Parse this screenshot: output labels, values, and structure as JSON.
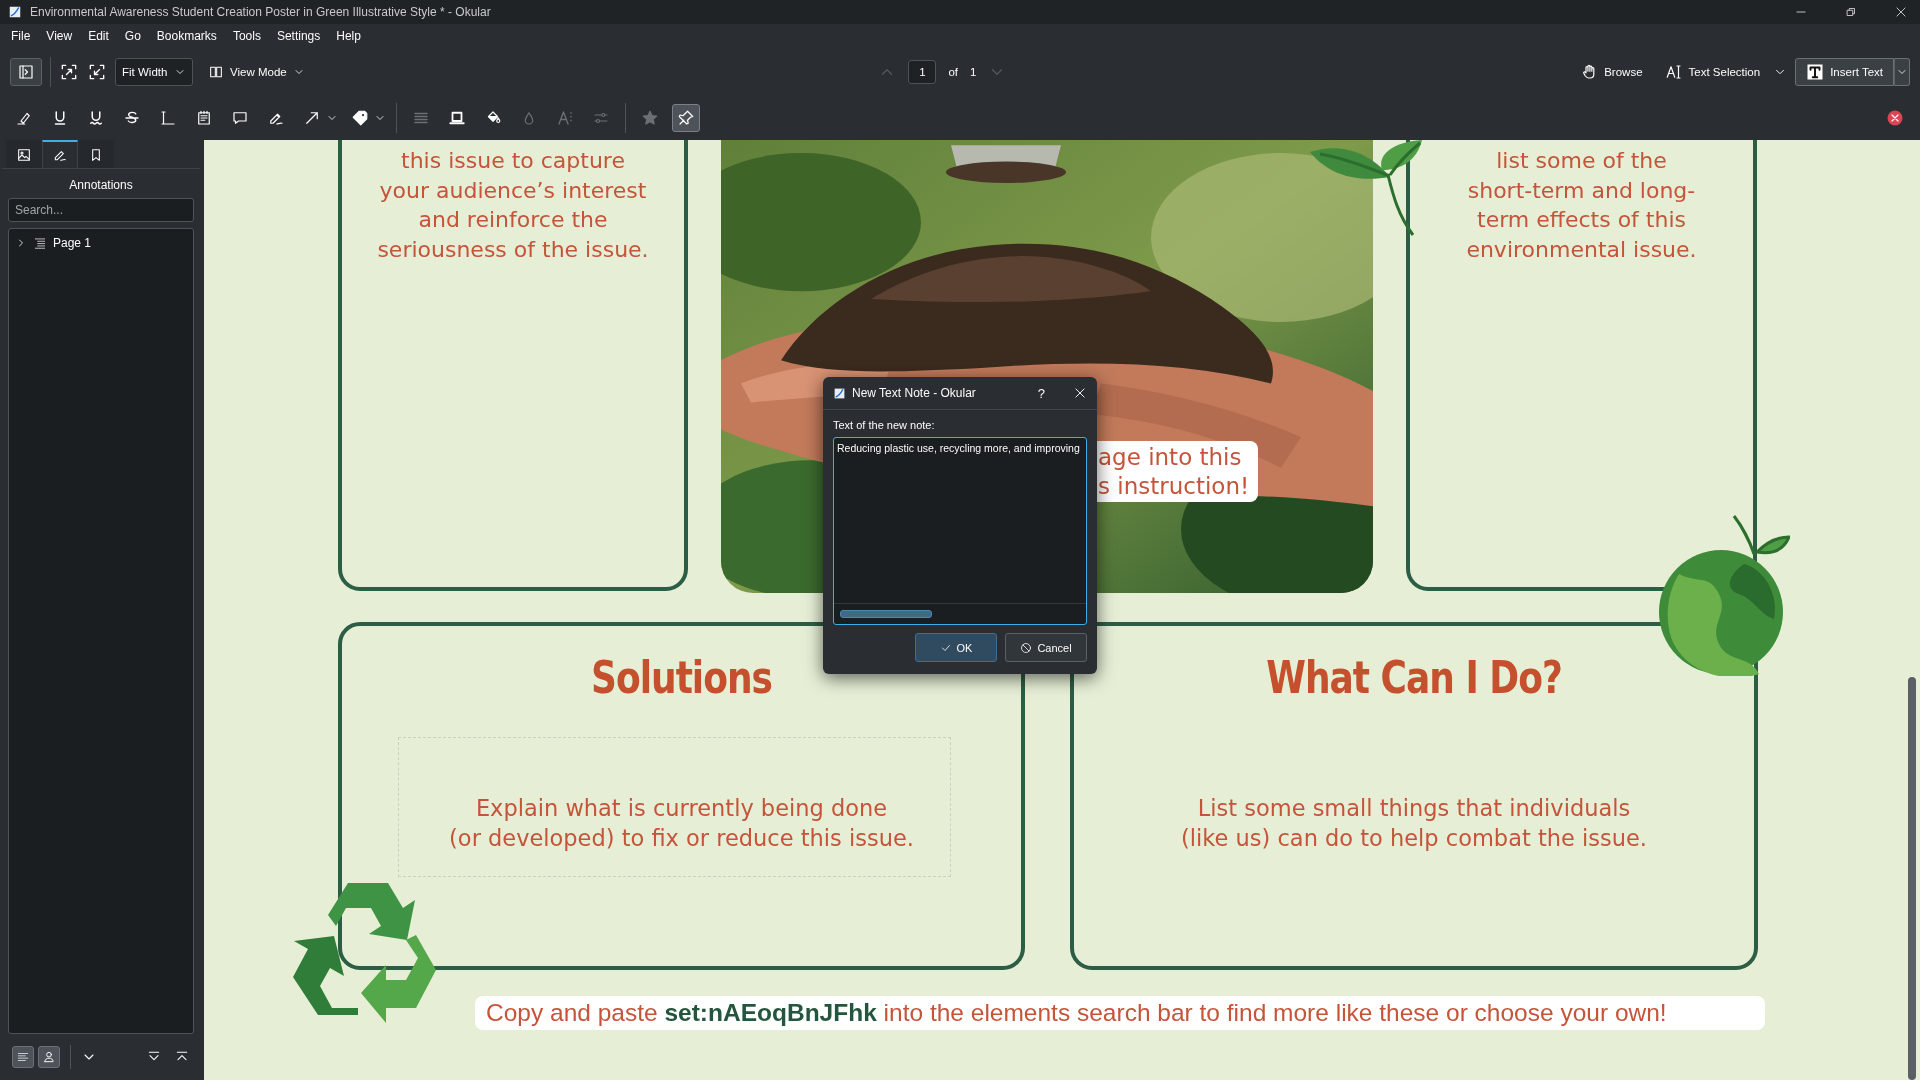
{
  "window": {
    "title": "Environmental Awareness Student Creation Poster in Green Illustrative Style * - Okular"
  },
  "menu": [
    "File",
    "View",
    "Edit",
    "Go",
    "Bookmarks",
    "Tools",
    "Settings",
    "Help"
  ],
  "toolbar": {
    "sidebar_toggle": {
      "on": true
    },
    "zoom": "Fit Width",
    "view_mode": "View Mode",
    "page": {
      "current": "1",
      "of": "of",
      "total": "1"
    },
    "modes": [
      {
        "kind": "browse",
        "label": "Browse",
        "selected": false
      },
      {
        "kind": "text_selection",
        "label": "Text Selection",
        "selected": false
      },
      {
        "kind": "insert_text",
        "label": "Insert Text",
        "selected": true
      }
    ]
  },
  "annotation_tool_groups": [
    {
      "tools": [
        {
          "kind": "highlighter",
          "disabled": false,
          "selected": false
        },
        {
          "kind": "underline",
          "disabled": false,
          "selected": false
        },
        {
          "kind": "squiggle",
          "disabled": false,
          "selected": false
        },
        {
          "kind": "strikeout",
          "disabled": false,
          "selected": false
        },
        {
          "kind": "typewriter",
          "disabled": false,
          "selected": false
        },
        {
          "kind": "note",
          "disabled": false,
          "selected": false
        },
        {
          "kind": "comment",
          "disabled": false,
          "selected": false
        },
        {
          "kind": "freehand",
          "disabled": false,
          "selected": false
        },
        {
          "kind": "arrow",
          "disabled": false,
          "selected": false,
          "has_menu": true
        },
        {
          "kind": "stamp",
          "disabled": false,
          "selected": false,
          "has_menu": true
        }
      ]
    },
    {
      "tools": [
        {
          "kind": "width",
          "disabled": true,
          "selected": false
        },
        {
          "kind": "border",
          "disabled": false,
          "selected": false
        },
        {
          "kind": "fill",
          "disabled": false,
          "selected": false
        },
        {
          "kind": "opacity",
          "disabled": true,
          "selected": false
        },
        {
          "kind": "font",
          "disabled": true,
          "selected": false
        },
        {
          "kind": "settings",
          "disabled": true,
          "selected": false
        }
      ]
    },
    {
      "tools": [
        {
          "kind": "star",
          "disabled": true,
          "selected": false
        },
        {
          "kind": "pin",
          "disabled": false,
          "selected": true
        }
      ]
    }
  ],
  "sidebar": {
    "tabs": [
      {
        "kind": "thumbnails",
        "selected": false
      },
      {
        "kind": "annotations",
        "selected": true
      },
      {
        "kind": "bookmarks",
        "selected": false
      }
    ],
    "title": "Annotations",
    "search": {
      "placeholder": "Search..."
    },
    "tree": [
      {
        "label": "Page 1",
        "expanded": false
      }
    ],
    "toggles": [
      {
        "kind": "list",
        "on": true
      },
      {
        "kind": "author",
        "on": true
      }
    ]
  },
  "document": {
    "cards": [
      {
        "kind": "text",
        "lines": [
          "this issue to capture",
          "your audience’s interest",
          "and reinforce the",
          "seriousness of the issue."
        ]
      },
      {
        "kind": "text",
        "lines": [
          "list some of the",
          "short-term and long-",
          "term effects of this",
          "environmental issue."
        ]
      },
      {
        "kind": "section",
        "title": "Solutions",
        "lines": [
          "Explain what is currently being done",
          "(or developed) to fix or reduce this issue."
        ],
        "dashed": true
      },
      {
        "kind": "section",
        "title": "What Can I Do?",
        "lines": [
          "List some small things that individuals",
          "(like us) can do to help combat the issue."
        ],
        "dashed": false
      }
    ],
    "photo_caption": [
      "age into this",
      "s instruction!"
    ],
    "banner": "Copy and paste **set:nAEoqBnJFhk** into the elements search bar to find more like these or choose your own!"
  },
  "dialog": {
    "title": "New Text Note - Okular",
    "help": "?",
    "label": "Text of the new note:",
    "value": "Reducing plastic use, recycling more, and improving",
    "buttons": [
      {
        "kind": "ok",
        "label": "OK",
        "default": true
      },
      {
        "kind": "cancel",
        "label": "Cancel",
        "default": false
      }
    ]
  }
}
